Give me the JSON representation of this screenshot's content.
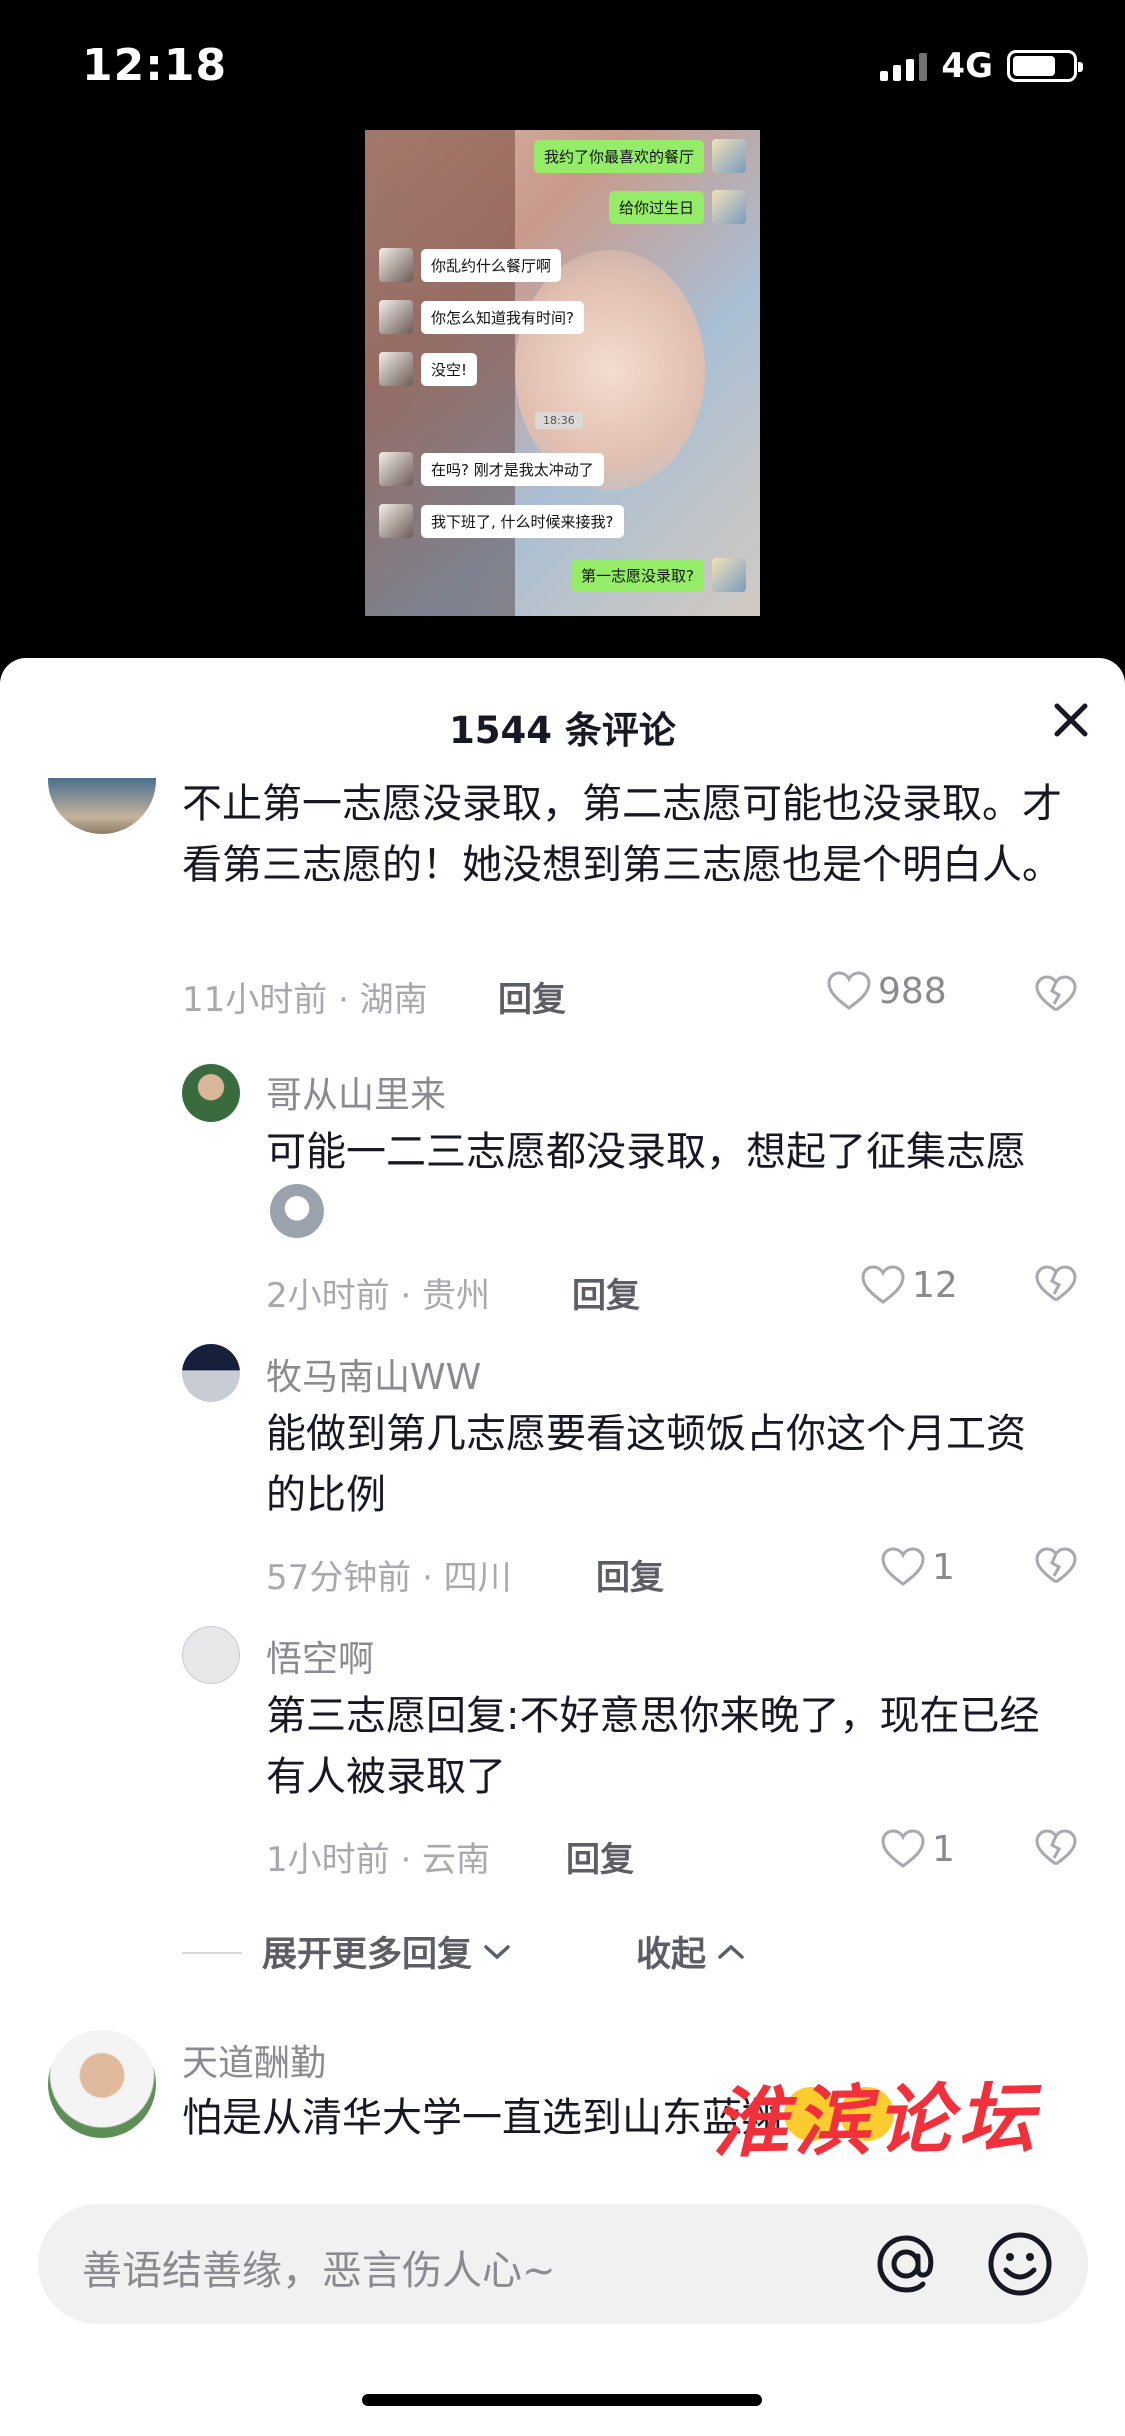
{
  "status_bar": {
    "time": "12:18",
    "network": "4G"
  },
  "video": {
    "chat_messages": [
      {
        "side": "right",
        "text": "我约了你最喜欢的餐厅"
      },
      {
        "side": "right",
        "text": "给你过生日"
      },
      {
        "side": "left",
        "text": "你乱约什么餐厅啊"
      },
      {
        "side": "left",
        "text": "你怎么知道我有时间?"
      },
      {
        "side": "left",
        "text": "没空!"
      },
      {
        "side": "left",
        "text": "在吗? 刚才是我太冲动了"
      },
      {
        "side": "left",
        "text": "我下班了, 什么时候来接我?"
      },
      {
        "side": "right",
        "text": "第一志愿没录取?"
      }
    ],
    "chat_time": "18:36"
  },
  "comments_sheet": {
    "title": "1544 条评论",
    "comments": [
      {
        "text": "不止第一志愿没录取，第二志愿可能也没录取。才看第三志愿的！她没想到第三志愿也是个明白人。",
        "meta": "11小时前 · 湖南",
        "reply_label": "回复",
        "likes": "988"
      }
    ],
    "replies": [
      {
        "user": "哥从山里来",
        "text": "可能一二三志愿都没录取，想起了征集志愿",
        "meta": "2小时前 · 贵州",
        "reply_label": "回复",
        "likes": "12"
      },
      {
        "user": "牧马南山WW",
        "text": "能做到第几志愿要看这顿饭占你这个月工资的比例",
        "meta": "57分钟前 · 四川",
        "reply_label": "回复",
        "likes": "1"
      },
      {
        "user": "悟空啊",
        "text": "第三志愿回复:不好意思你来晚了，现在已经有人被录取了",
        "meta": "1小时前 · 云南",
        "reply_label": "回复",
        "likes": "1"
      }
    ],
    "expand_more_label": "展开更多回复",
    "collapse_label": "收起",
    "last_comment": {
      "user": "天道酬勤",
      "text": "怕是从清华大学一直选到山东蓝翔"
    },
    "watermark": "淮滨论坛"
  },
  "input_bar": {
    "placeholder": "善语结善缘，恶言伤人心~"
  },
  "icons": [
    "close-icon",
    "heart-icon",
    "dislike-heart-icon",
    "chevron-down-icon",
    "chevron-up-icon",
    "at-icon",
    "emoji-icon"
  ],
  "colors": {
    "sheet_bg": "#ffffff",
    "text_primary": "#161823",
    "text_secondary": "#8a8b91",
    "bubble_green": "#95ec69"
  }
}
